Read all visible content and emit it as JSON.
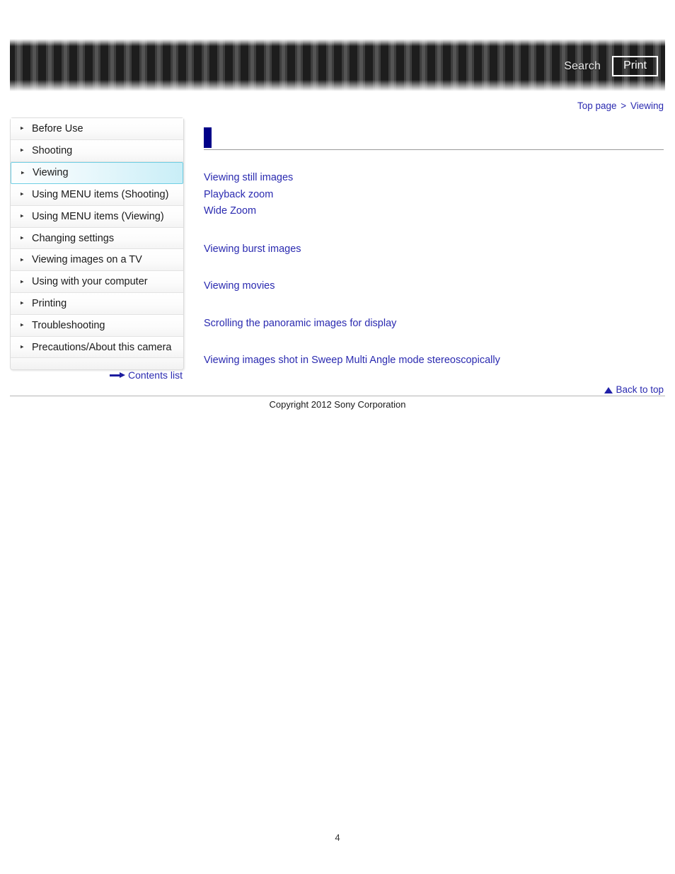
{
  "header": {
    "search_label": "Search",
    "print_label": "Print",
    "search_icon": "search-icon",
    "print_icon": "print-icon"
  },
  "breadcrumb": {
    "items": [
      "Top page",
      "Viewing"
    ],
    "separator": ">"
  },
  "sidebar": {
    "bullet_glyph": "▸",
    "items": [
      {
        "label": "Before Use",
        "active": false
      },
      {
        "label": "Shooting",
        "active": false
      },
      {
        "label": "Viewing",
        "active": true
      },
      {
        "label": "Using MENU items (Shooting)",
        "active": false
      },
      {
        "label": "Using MENU items (Viewing)",
        "active": false
      },
      {
        "label": "Changing settings",
        "active": false
      },
      {
        "label": "Viewing images on a TV",
        "active": false
      },
      {
        "label": "Using with your computer",
        "active": false
      },
      {
        "label": "Printing",
        "active": false
      },
      {
        "label": "Troubleshooting",
        "active": false
      },
      {
        "label": "Precautions/About this camera",
        "active": false
      }
    ],
    "contents_list_label": "Contents list",
    "contents_list_icon": "arrow-right-icon"
  },
  "main": {
    "title": "",
    "groups": [
      {
        "links": [
          "Viewing still images",
          "Playback zoom",
          "Wide Zoom"
        ]
      },
      {
        "links": [
          "Viewing burst images"
        ]
      },
      {
        "links": [
          "Viewing movies"
        ]
      },
      {
        "links": [
          "Scrolling the panoramic images for display"
        ]
      },
      {
        "links": [
          "Viewing images shot in Sweep Multi Angle mode stereoscopically"
        ]
      }
    ]
  },
  "footer": {
    "back_to_top_label": "Back to top",
    "back_to_top_icon": "triangle-up-icon",
    "copyright": "Copyright 2012 Sony Corporation",
    "page_number": "4"
  },
  "colors": {
    "link": "#2a2ab0",
    "heading_marker": "#000088",
    "active_nav_border": "#6fcfe4",
    "header_dark": "#1d1d1d"
  }
}
